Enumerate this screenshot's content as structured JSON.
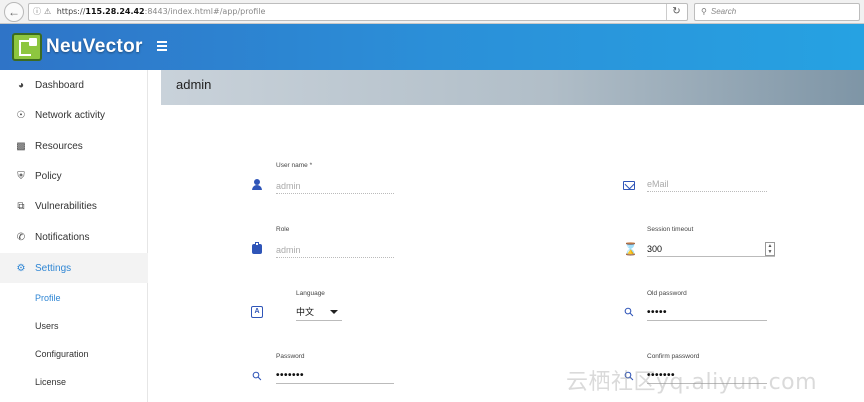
{
  "browser": {
    "url_host": "115.28.24.42",
    "url_path": ":8443/index.html#/app/profile",
    "search_placeholder": "Search"
  },
  "app": {
    "brand": "NeuVector"
  },
  "sidebar": {
    "items": [
      {
        "label": "Dashboard",
        "icon": "dashboard-gauge-icon"
      },
      {
        "label": "Network activity",
        "icon": "globe-icon"
      },
      {
        "label": "Resources",
        "icon": "cubes-icon"
      },
      {
        "label": "Policy",
        "icon": "shield-icon"
      },
      {
        "label": "Vulnerabilities",
        "icon": "bug-document-icon"
      },
      {
        "label": "Notifications",
        "icon": "phone-icon"
      },
      {
        "label": "Settings",
        "icon": "gear-icon"
      }
    ],
    "settings_sub": [
      {
        "label": "Profile"
      },
      {
        "label": "Users"
      },
      {
        "label": "Configuration"
      },
      {
        "label": "License"
      }
    ]
  },
  "page": {
    "title": "admin"
  },
  "form": {
    "username_label": "User name *",
    "username_value": "admin",
    "email_placeholder": "eMail",
    "role_label": "Role",
    "role_value": "admin",
    "session_label": "Session timeout",
    "session_value": "300",
    "language_label": "Language",
    "language_value": "中文",
    "old_password_label": "Old password",
    "old_password_value": "•••••",
    "password_label": "Password",
    "password_value": "•••••••",
    "confirm_password_label": "Confirm password",
    "confirm_password_value": "•••••••"
  },
  "watermark": "云栖社区yq.aliyun.com",
  "colors": {
    "header_start": "#2f74c7",
    "header_end": "#26a2e2",
    "accent": "#2f86d4",
    "icon_blue": "#2f55b8"
  }
}
